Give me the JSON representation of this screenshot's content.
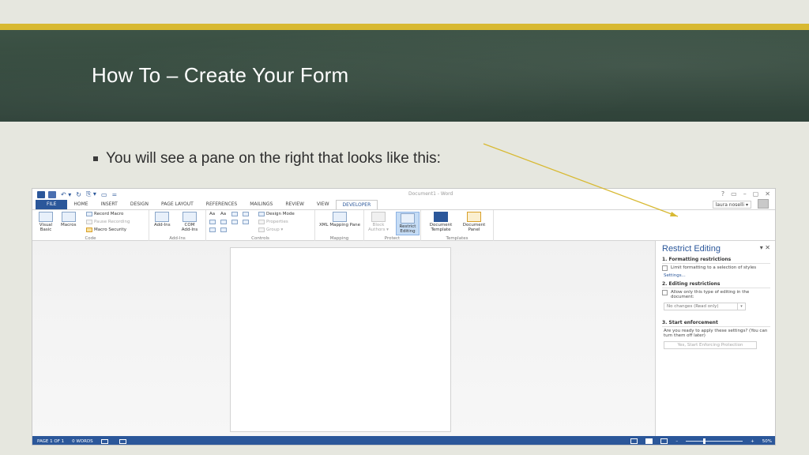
{
  "slide": {
    "title": "How To – Create Your Form",
    "bullet": "You will see a pane on the right that looks like this:",
    "colors": {
      "stripe": "#d8b932",
      "band": "#354a3e",
      "arrow": "#d8b932"
    }
  },
  "word": {
    "qat_glyphs": [
      "↶ ▾",
      "↻",
      "⎘ ▾",
      "▭",
      "="
    ],
    "doc_title": "Document1 - Word",
    "window_controls": [
      "?",
      "▭",
      "–",
      "▢",
      "✕"
    ],
    "tabs": [
      "FILE",
      "HOME",
      "INSERT",
      "DESIGN",
      "PAGE LAYOUT",
      "REFERENCES",
      "MAILINGS",
      "REVIEW",
      "VIEW",
      "DEVELOPER"
    ],
    "active_tab": "DEVELOPER",
    "user": "laura noselli ▾",
    "ribbon": {
      "code": {
        "label": "Code",
        "visual_basic": "Visual Basic",
        "macros": "Macros",
        "record_macro": "Record Macro",
        "pause_recording": "Pause Recording",
        "macro_security": "Macro Security"
      },
      "addins": {
        "label": "Add-Ins",
        "addins": "Add-Ins",
        "com": "COM Add-Ins"
      },
      "controls": {
        "label": "Controls",
        "aa1": "Aa",
        "aa2": "Aa",
        "design_mode": "Design Mode",
        "properties": "Properties",
        "group": "Group ▾"
      },
      "mapping": {
        "label": "Mapping",
        "xml": "XML Mapping Pane"
      },
      "protect": {
        "label": "Protect",
        "block_authors": "Block Authors ▾",
        "restrict_editing": "Restrict Editing"
      },
      "templates": {
        "label": "Templates",
        "document_template": "Document Template",
        "document_panel": "Document Panel"
      }
    },
    "pane": {
      "title": "Restrict Editing",
      "controls": "▾ ✕",
      "sec1": "1. Formatting restrictions",
      "sec1_check": "Limit formatting to a selection of styles",
      "settings_link": "Settings...",
      "sec2": "2. Editing restrictions",
      "sec2_check": "Allow only this type of editing in the document:",
      "select_value": "No changes (Read only)",
      "sec3": "3. Start enforcement",
      "sec3_text": "Are you ready to apply these settings? (You can turn them off later)",
      "enforce_button": "Yes, Start Enforcing Protection"
    },
    "status": {
      "page": "PAGE 1 OF 1",
      "words": "0 WORDS",
      "zoom_minus": "–",
      "zoom_plus": "+",
      "zoom": "50%",
      "zoom_level": 0.3
    }
  }
}
